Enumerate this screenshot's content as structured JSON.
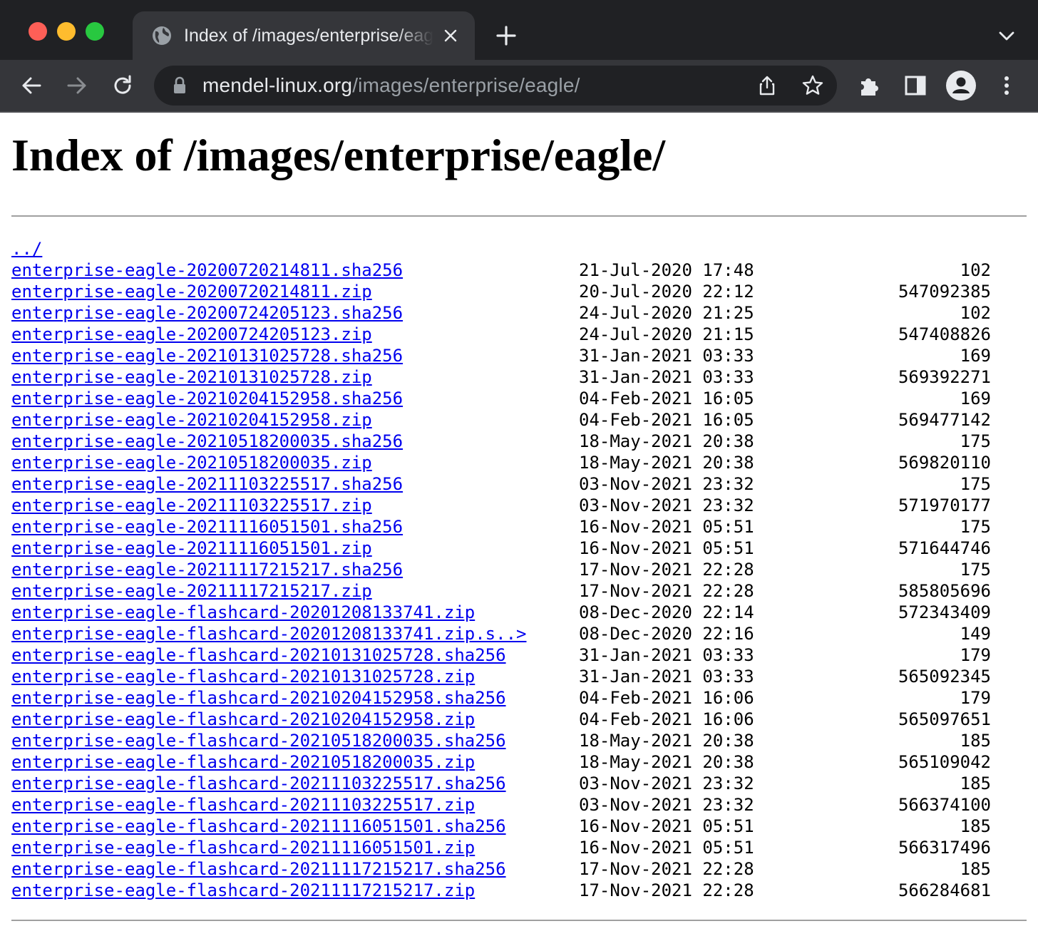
{
  "browser": {
    "tab_title": "Index of /images/enterprise/eagle/",
    "url_host": "mendel-linux.org",
    "url_path": "/images/enterprise/eagle/"
  },
  "page": {
    "heading": "Index of /images/enterprise/eagle/",
    "parent_link": "../",
    "entries": [
      {
        "name": "enterprise-eagle-20200720214811.sha256",
        "date": "21-Jul-2020 17:48",
        "size": "102"
      },
      {
        "name": "enterprise-eagle-20200720214811.zip",
        "date": "20-Jul-2020 22:12",
        "size": "547092385"
      },
      {
        "name": "enterprise-eagle-20200724205123.sha256",
        "date": "24-Jul-2020 21:25",
        "size": "102"
      },
      {
        "name": "enterprise-eagle-20200724205123.zip",
        "date": "24-Jul-2020 21:15",
        "size": "547408826"
      },
      {
        "name": "enterprise-eagle-20210131025728.sha256",
        "date": "31-Jan-2021 03:33",
        "size": "169"
      },
      {
        "name": "enterprise-eagle-20210131025728.zip",
        "date": "31-Jan-2021 03:33",
        "size": "569392271"
      },
      {
        "name": "enterprise-eagle-20210204152958.sha256",
        "date": "04-Feb-2021 16:05",
        "size": "169"
      },
      {
        "name": "enterprise-eagle-20210204152958.zip",
        "date": "04-Feb-2021 16:05",
        "size": "569477142"
      },
      {
        "name": "enterprise-eagle-20210518200035.sha256",
        "date": "18-May-2021 20:38",
        "size": "175"
      },
      {
        "name": "enterprise-eagle-20210518200035.zip",
        "date": "18-May-2021 20:38",
        "size": "569820110"
      },
      {
        "name": "enterprise-eagle-20211103225517.sha256",
        "date": "03-Nov-2021 23:32",
        "size": "175"
      },
      {
        "name": "enterprise-eagle-20211103225517.zip",
        "date": "03-Nov-2021 23:32",
        "size": "571970177"
      },
      {
        "name": "enterprise-eagle-20211116051501.sha256",
        "date": "16-Nov-2021 05:51",
        "size": "175"
      },
      {
        "name": "enterprise-eagle-20211116051501.zip",
        "date": "16-Nov-2021 05:51",
        "size": "571644746"
      },
      {
        "name": "enterprise-eagle-20211117215217.sha256",
        "date": "17-Nov-2021 22:28",
        "size": "175"
      },
      {
        "name": "enterprise-eagle-20211117215217.zip",
        "date": "17-Nov-2021 22:28",
        "size": "585805696"
      },
      {
        "name": "enterprise-eagle-flashcard-20201208133741.zip",
        "date": "08-Dec-2020 22:14",
        "size": "572343409"
      },
      {
        "name": "enterprise-eagle-flashcard-20201208133741.zip.s..>",
        "date": "08-Dec-2020 22:16",
        "size": "149"
      },
      {
        "name": "enterprise-eagle-flashcard-20210131025728.sha256",
        "date": "31-Jan-2021 03:33",
        "size": "179"
      },
      {
        "name": "enterprise-eagle-flashcard-20210131025728.zip",
        "date": "31-Jan-2021 03:33",
        "size": "565092345"
      },
      {
        "name": "enterprise-eagle-flashcard-20210204152958.sha256",
        "date": "04-Feb-2021 16:06",
        "size": "179"
      },
      {
        "name": "enterprise-eagle-flashcard-20210204152958.zip",
        "date": "04-Feb-2021 16:06",
        "size": "565097651"
      },
      {
        "name": "enterprise-eagle-flashcard-20210518200035.sha256",
        "date": "18-May-2021 20:38",
        "size": "185"
      },
      {
        "name": "enterprise-eagle-flashcard-20210518200035.zip",
        "date": "18-May-2021 20:38",
        "size": "565109042"
      },
      {
        "name": "enterprise-eagle-flashcard-20211103225517.sha256",
        "date": "03-Nov-2021 23:32",
        "size": "185"
      },
      {
        "name": "enterprise-eagle-flashcard-20211103225517.zip",
        "date": "03-Nov-2021 23:32",
        "size": "566374100"
      },
      {
        "name": "enterprise-eagle-flashcard-20211116051501.sha256",
        "date": "16-Nov-2021 05:51",
        "size": "185"
      },
      {
        "name": "enterprise-eagle-flashcard-20211116051501.zip",
        "date": "16-Nov-2021 05:51",
        "size": "566317496"
      },
      {
        "name": "enterprise-eagle-flashcard-20211117215217.sha256",
        "date": "17-Nov-2021 22:28",
        "size": "185"
      },
      {
        "name": "enterprise-eagle-flashcard-20211117215217.zip",
        "date": "17-Nov-2021 22:28",
        "size": "566284681"
      }
    ]
  },
  "icons": {
    "tab_favicon": "globe-icon",
    "tab_close": "close-icon",
    "new_tab": "plus-icon",
    "tab_search": "chevron-down-icon",
    "back": "arrow-left-icon",
    "forward": "arrow-right-icon",
    "reload": "reload-icon",
    "lock": "lock-icon",
    "share": "share-icon",
    "bookmark": "star-icon",
    "extensions": "puzzle-icon",
    "side_panel": "side-panel-icon",
    "profile": "profile-icon",
    "menu": "kebab-menu-icon"
  },
  "colors": {
    "link": "#0000ee",
    "chrome_dark": "#202124",
    "chrome_toolbar": "#35363a"
  }
}
